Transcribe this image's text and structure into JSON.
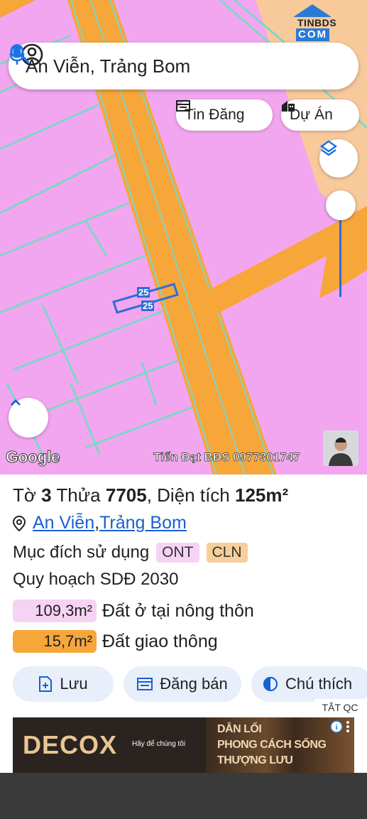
{
  "search": {
    "text": "An Viễn, Trảng Bom"
  },
  "chips": {
    "tin_dang": "Tin Đăng",
    "du_an": "Dự Án"
  },
  "watermark": {
    "line1": "TINBDS",
    "line2": "COM"
  },
  "plot_labels": {
    "top": "25",
    "bottom": "25"
  },
  "map_footer": {
    "google": "Google",
    "author": "Tiến Đạt BĐS 0977301747"
  },
  "info": {
    "to_label": "Tờ",
    "to_value": "3",
    "thua_label": "Thửa",
    "thua_value": "7705",
    "dien_tich_label": "Diện tích",
    "dien_tich_value": "125m²",
    "location": {
      "commune": "An Viễn",
      "separator": ", ",
      "district": "Trảng Bom"
    },
    "muc_dich_label": "Mục đích sử dụng",
    "tags": [
      "ONT",
      "CLN"
    ],
    "quy_hoach": "Quy hoạch SDĐ 2030",
    "land_uses": [
      {
        "area": "109,3m²",
        "label": "Đất ở tại nông thôn",
        "color": "#f6d3f4"
      },
      {
        "area": "15,7m²",
        "label": "Đất giao thông",
        "color": "#f7a63a"
      }
    ]
  },
  "actions": {
    "luu": "Lưu",
    "dang_ban": "Đăng bán",
    "chu_thich": "Chú thích"
  },
  "ad": {
    "close_label": "TẮT QC",
    "brand": "DECOX",
    "tagline": "Hãy để chúng tôi",
    "line1": "DẪN LỐI",
    "line2": "PHONG CÁCH SỐNG",
    "line3": "THƯỢNG LƯU"
  },
  "colors": {
    "land_pink": "#f3a6f0",
    "road_orange": "#f7a63a",
    "accent_blue": "#1a5fd0"
  }
}
